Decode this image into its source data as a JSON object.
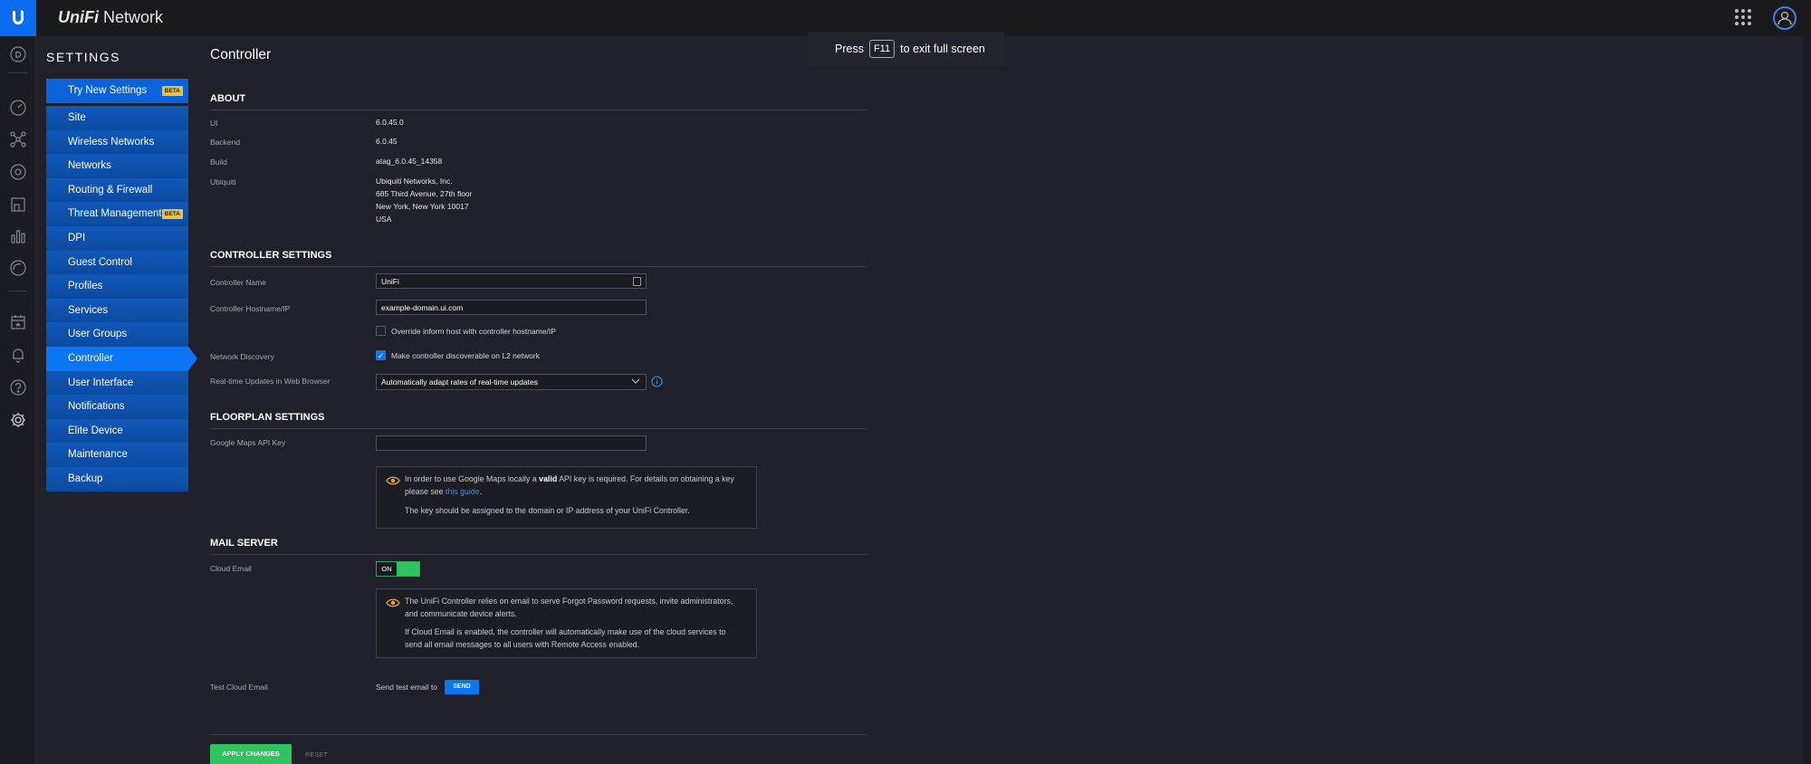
{
  "app": {
    "brand_logo": "UniFi",
    "brand_name": "Network"
  },
  "fullscreen_banner": {
    "press": "Press",
    "key": "F11",
    "rest": "to exit full screen"
  },
  "iconbar": {
    "device_badge": "D"
  },
  "settings": {
    "title": "SETTINGS",
    "items": [
      {
        "label": "Try New Settings",
        "badge": "BETA"
      },
      {
        "label": "Site"
      },
      {
        "label": "Wireless Networks"
      },
      {
        "label": "Networks"
      },
      {
        "label": "Routing & Firewall"
      },
      {
        "label": "Threat Management",
        "badge": "BETA"
      },
      {
        "label": "DPI"
      },
      {
        "label": "Guest Control"
      },
      {
        "label": "Profiles"
      },
      {
        "label": "Services"
      },
      {
        "label": "User Groups"
      },
      {
        "label": "Controller",
        "active": true
      },
      {
        "label": "User Interface"
      },
      {
        "label": "Notifications"
      },
      {
        "label": "Elite Device"
      },
      {
        "label": "Maintenance"
      },
      {
        "label": "Backup"
      }
    ]
  },
  "page": {
    "title": "Controller"
  },
  "about": {
    "heading": "ABOUT",
    "ui_label": "UI",
    "ui_value": "6.0.45.0",
    "backend_label": "Backend",
    "backend_value": "6.0.45",
    "build_label": "Build",
    "build_value": "atag_6.0.45_14358",
    "ubiquiti_label": "Ubiquiti",
    "address": [
      "Ubiquiti Networks, Inc.",
      "685 Third Avenue, 27th floor",
      "New York, New York 10017",
      "USA"
    ]
  },
  "controller_settings": {
    "heading": "CONTROLLER SETTINGS",
    "name_label": "Controller Name",
    "name_value": "UniFi",
    "hostname_label": "Controller Hostname/IP",
    "hostname_value": "example-domain.ui.com",
    "override_label": "Override inform host with controller hostname/IP",
    "override_checked": false,
    "discovery_label": "Network Discovery",
    "discovery_check_label": "Make controller discoverable on L2 network",
    "discovery_checked": true,
    "realtime_label": "Real-time Updates in Web Browser",
    "realtime_value": "Automatically adapt rates of real-time updates"
  },
  "floorplan": {
    "heading": "FLOORPLAN SETTINGS",
    "maps_label": "Google Maps API Key",
    "maps_value": "",
    "info_pre": "In order to use Google Maps locally a",
    "info_bold": "valid",
    "info_mid": "API key is required. For details on obtaining a key",
    "info_line2_pre": "please see",
    "info_link": "this guide",
    "info_line2_post": ".",
    "info_p2": "The key should be assigned to the domain or IP address of your UniFi Controller."
  },
  "mail_server": {
    "heading": "MAIL SERVER",
    "cloud_label": "Cloud Email",
    "toggle_label": "ON",
    "info_p1_l1": "The UniFi Controller relies on email to serve Forgot Password requests, invite administrators,",
    "info_p1_l2": "and communicate device alerts.",
    "info_p2_l1": "If Cloud Email is enabled, the controller will automatically make use of the cloud services to",
    "info_p2_l2": "send all email messages to all users with Remote Access enabled.",
    "test_label": "Test Cloud Email",
    "send_text": "Send test email to",
    "send_button": "SEND"
  },
  "actions": {
    "apply": "APPLY CHANGES",
    "reset": "RESET"
  },
  "colors": {
    "accent": "#0a75f5",
    "success": "#2fc45e",
    "beta": "#e8c04a",
    "info_icon": "#e8a33a"
  }
}
